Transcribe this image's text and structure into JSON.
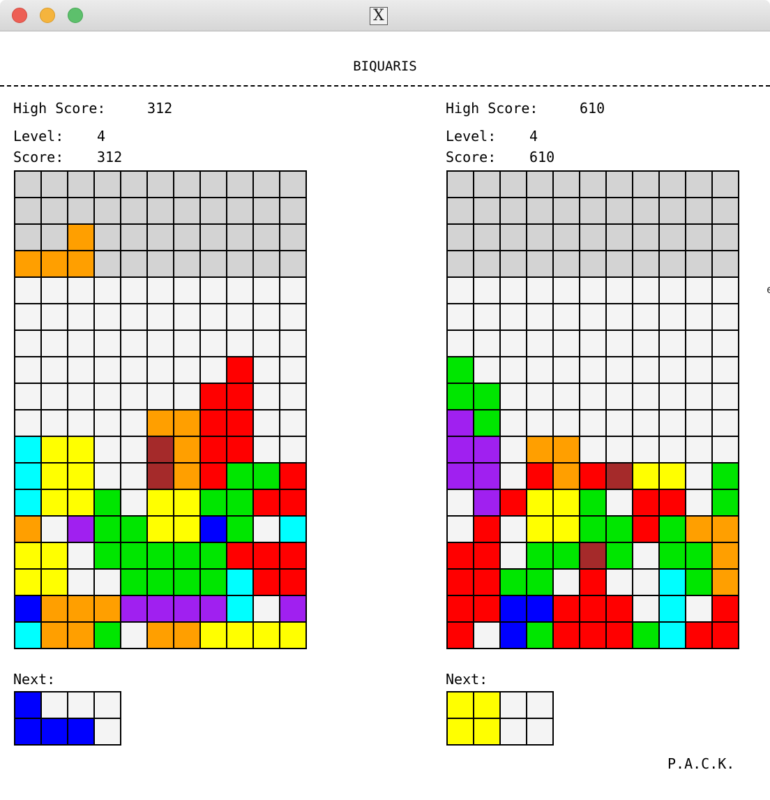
{
  "window": {
    "title_icon": "x11-icon"
  },
  "app_title": "BIQUARIS",
  "colors": {
    "empty": "#f4f4f4",
    "hidden": "#d3d3d3",
    "O": "#ff9f00",
    "R": "#ff0000",
    "Y": "#ffff00",
    "G": "#00e600",
    "C": "#00ffff",
    "P": "#a020f0",
    "B": "#0000ff",
    "M": "#a52a2a"
  },
  "hidden_rows": 4,
  "players": [
    {
      "high_score_label": "High Score:",
      "high_score": "312",
      "level_label": "Level:",
      "level": "4",
      "score_label": "Score:",
      "score": "312",
      "next_label": "Next:",
      "board": [
        "...........",
        "...........",
        "..O........",
        "OOO........",
        "...........",
        "...........",
        "...........",
        "........R..",
        ".......RR..",
        ".....OORR..",
        "CYY..MORR..",
        "CYY..MORGGR",
        "CYYG.YYGGRR",
        "O.PGGYYBG.C",
        "YY.GGGGGRRR",
        "YY..GGGGCRR",
        "BOOOPPPPC.P",
        "COOG.OOYYYY"
      ],
      "next": [
        "B...",
        "BBB."
      ]
    },
    {
      "high_score_label": "High Score:",
      "high_score": "610",
      "level_label": "Level:",
      "level": "4",
      "score_label": "Score:",
      "score": "610",
      "next_label": "Next:",
      "board": [
        "...........",
        "...........",
        "...........",
        "...........",
        "...........",
        "...........",
        "...........",
        "G..........",
        "GG.........",
        "PG.........",
        "PP.OO......",
        "PP.RORMYY.G",
        ".PRYYG.RR.G",
        ".R.YYGGRGOO",
        "RR.GGMG.GGO",
        "RRGG.R..CGO",
        "RRBBRRR.C.R",
        "R.BGRRRGCRR"
      ],
      "next": [
        "YY..",
        "YY.."
      ]
    }
  ],
  "credit": "P.A.C.K.",
  "edge_fragment": "e"
}
